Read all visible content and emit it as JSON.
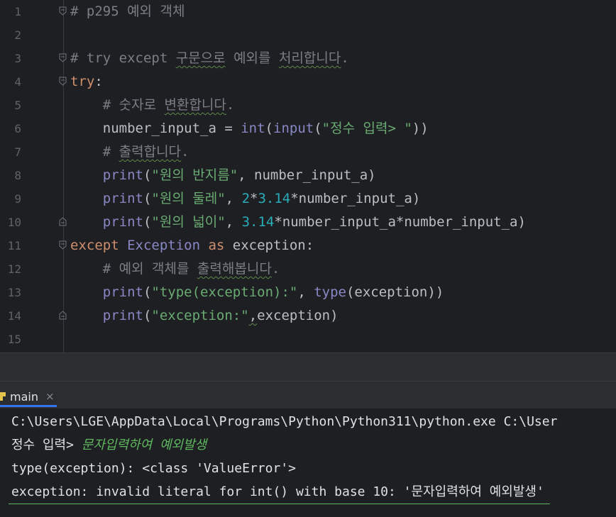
{
  "editor": {
    "lines": [
      {
        "n": "1",
        "tokens": [
          {
            "t": "# p295 예외 객체",
            "c": "cm"
          }
        ]
      },
      {
        "n": "2",
        "tokens": []
      },
      {
        "n": "3",
        "tokens": [
          {
            "t": "# try except ",
            "c": "cm"
          },
          {
            "t": "구문으로",
            "c": "cm sq"
          },
          {
            "t": " 예외를 ",
            "c": "cm"
          },
          {
            "t": "처리합니다",
            "c": "cm sq"
          },
          {
            "t": ".",
            "c": "cm"
          }
        ]
      },
      {
        "n": "4",
        "tokens": [
          {
            "t": "try",
            "c": "kw"
          },
          {
            "t": ":",
            "c": ""
          }
        ]
      },
      {
        "n": "5",
        "tokens": [
          {
            "t": "    # 숫자로 ",
            "c": "cm"
          },
          {
            "t": "변환합니다",
            "c": "cm sq"
          },
          {
            "t": ".",
            "c": "cm"
          }
        ]
      },
      {
        "n": "6",
        "tokens": [
          {
            "t": "    number_input_a = ",
            "c": ""
          },
          {
            "t": "int",
            "c": "fn"
          },
          {
            "t": "(",
            "c": ""
          },
          {
            "t": "input",
            "c": "fn"
          },
          {
            "t": "(",
            "c": ""
          },
          {
            "t": "\"정수 입력> \"",
            "c": "st"
          },
          {
            "t": "))",
            "c": ""
          }
        ]
      },
      {
        "n": "7",
        "tokens": [
          {
            "t": "    # ",
            "c": "cm"
          },
          {
            "t": "출력합니다",
            "c": "cm sq"
          },
          {
            "t": ".",
            "c": "cm"
          }
        ]
      },
      {
        "n": "8",
        "tokens": [
          {
            "t": "    ",
            "c": ""
          },
          {
            "t": "print",
            "c": "fn"
          },
          {
            "t": "(",
            "c": ""
          },
          {
            "t": "\"원의 반지름\"",
            "c": "st"
          },
          {
            "t": ", number_input_a)",
            "c": ""
          }
        ]
      },
      {
        "n": "9",
        "tokens": [
          {
            "t": "    ",
            "c": ""
          },
          {
            "t": "print",
            "c": "fn"
          },
          {
            "t": "(",
            "c": ""
          },
          {
            "t": "\"원의 둘레\"",
            "c": "st"
          },
          {
            "t": ", ",
            "c": ""
          },
          {
            "t": "2",
            "c": "nm"
          },
          {
            "t": "*",
            "c": ""
          },
          {
            "t": "3.14",
            "c": "nm"
          },
          {
            "t": "*number_input_a)",
            "c": ""
          }
        ]
      },
      {
        "n": "10",
        "tokens": [
          {
            "t": "    ",
            "c": ""
          },
          {
            "t": "print",
            "c": "fn"
          },
          {
            "t": "(",
            "c": ""
          },
          {
            "t": "\"원의 넓이\"",
            "c": "st"
          },
          {
            "t": ", ",
            "c": ""
          },
          {
            "t": "3.14",
            "c": "nm"
          },
          {
            "t": "*number_input_a*number_input_a)",
            "c": ""
          }
        ]
      },
      {
        "n": "11",
        "tokens": [
          {
            "t": "except ",
            "c": "kw"
          },
          {
            "t": "Exception",
            "c": "cls"
          },
          {
            "t": " as ",
            "c": "kw"
          },
          {
            "t": "exception:",
            "c": ""
          }
        ]
      },
      {
        "n": "12",
        "tokens": [
          {
            "t": "    # 예외 객체를 ",
            "c": "cm"
          },
          {
            "t": "출력해봅니다",
            "c": "cm sq"
          },
          {
            "t": ".",
            "c": "cm"
          }
        ]
      },
      {
        "n": "13",
        "tokens": [
          {
            "t": "    ",
            "c": ""
          },
          {
            "t": "print",
            "c": "fn"
          },
          {
            "t": "(",
            "c": ""
          },
          {
            "t": "\"type(exception):\"",
            "c": "st"
          },
          {
            "t": ", ",
            "c": ""
          },
          {
            "t": "type",
            "c": "fn"
          },
          {
            "t": "(exception))",
            "c": ""
          }
        ]
      },
      {
        "n": "14",
        "tokens": [
          {
            "t": "    ",
            "c": ""
          },
          {
            "t": "print",
            "c": "fn"
          },
          {
            "t": "(",
            "c": ""
          },
          {
            "t": "\"exception:\"",
            "c": "st"
          },
          {
            "t": ",",
            "c": "sq"
          },
          {
            "t": "exception)",
            "c": ""
          }
        ]
      },
      {
        "n": "15",
        "tokens": []
      }
    ],
    "fold_markers": {
      "1": "open",
      "3": "open",
      "4": "open",
      "10": "close",
      "11": "open",
      "14": "close"
    }
  },
  "run_panel": {
    "tab_label": "main",
    "tab_close": "×",
    "tab_icon": "python-run-icon"
  },
  "console": {
    "cmd_line": "C:\\Users\\LGE\\AppData\\Local\\Programs\\Python\\Python311\\python.exe C:\\User",
    "prompt": "정수 입력> ",
    "user_input": "문자입력하여 예외발생",
    "type_line": "type(exception): <class 'ValueError'>",
    "error_line": "exception: invalid literal for int() with base 10: '문자입력하여 예외발생'"
  },
  "colors": {
    "background": "#1e1f22",
    "keyword": "#cf8e6d",
    "builtin": "#8888c6",
    "string": "#6aab73",
    "number": "#2aacb8",
    "comment": "#7a7e85",
    "console_input": "#5fb85f"
  }
}
